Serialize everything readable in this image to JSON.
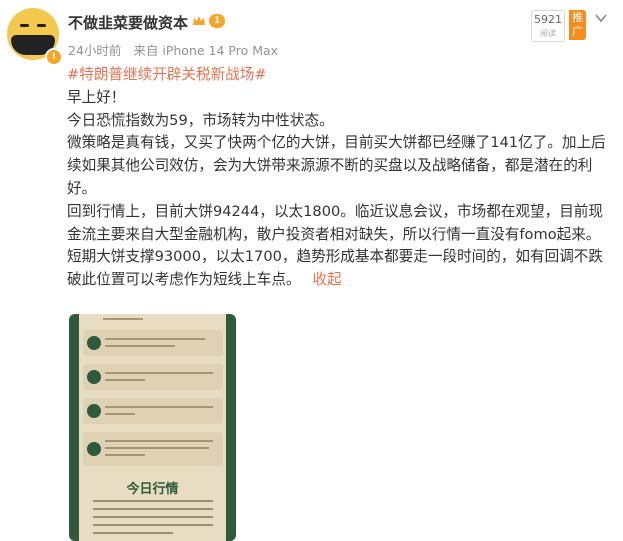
{
  "user": {
    "name": "不做韭菜要做资本",
    "level": "1",
    "time": "24小时前",
    "source": "来自 iPhone 14 Pro Max"
  },
  "stats": {
    "views": "5921",
    "views_label": "阅读",
    "promote_label": "推广"
  },
  "post": {
    "topic": "#特朗普继续开辟关税新战场#",
    "greeting": "早上好！",
    "p1": "今日恐慌指数为59，市场转为中性状态。",
    "p2": "微策略是真有钱，又买了快两个亿的大饼，目前买大饼都已经赚了141亿了。加上后续如果其他公司效仿，会为大饼带来源源不断的买盘以及战略储备，都是潜在的利好。",
    "p3": "回到行情上，目前大饼94244，以太1800。临近议息会议，市场都在观望，目前现金流主要来自大型金融机构，散户投资者相对缺失，所以行情一直没有fomo起来。短期大饼支撑93000，以太1700，趋势形成基本都要走一段时间的，如有回调不跌破此位置可以考虑作为短线上车点。",
    "fold": "收起"
  },
  "card": {
    "section_title": "今日行情"
  },
  "colors": {
    "accent": "#eb7350",
    "promote": "#f48d1b",
    "card_green": "#2f5a3c",
    "card_bg": "#e8dcc2"
  }
}
